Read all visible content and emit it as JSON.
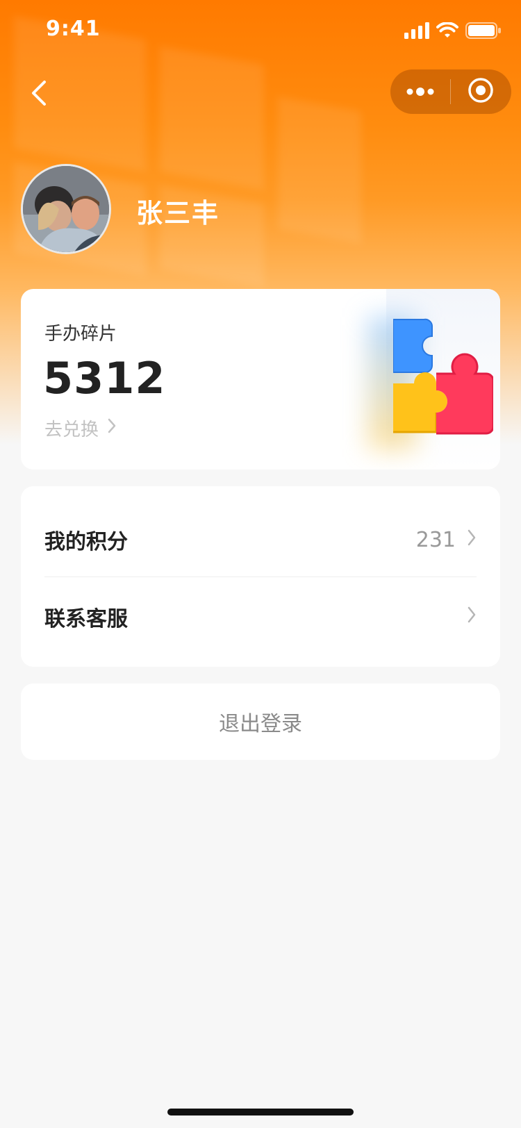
{
  "status_bar": {
    "time": "9:41",
    "icons": [
      "signal-icon",
      "wifi-icon",
      "battery-icon"
    ]
  },
  "nav": {
    "back_icon": "chevron-left-icon",
    "capsule_more_icon": "more-dots-icon",
    "capsule_close_icon": "target-circle-icon"
  },
  "profile": {
    "username": "张三丰"
  },
  "fragments_card": {
    "title": "手办碎片",
    "value": "5312",
    "link_label": "去兑换",
    "illustration": "puzzle-pieces-illustration"
  },
  "menu": {
    "items": [
      {
        "label": "我的积分",
        "value": "231"
      },
      {
        "label": "联系客服",
        "value": ""
      }
    ]
  },
  "logout": {
    "label": "退出登录"
  },
  "colors": {
    "brand_orange": "#ff7a00",
    "page_bg": "#f7f7f7"
  }
}
